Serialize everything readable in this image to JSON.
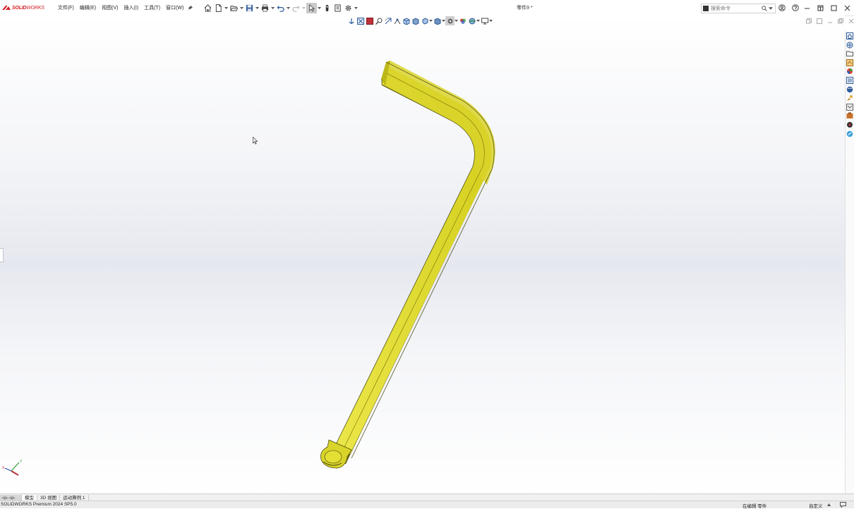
{
  "app": {
    "logo_bold": "SOLID",
    "logo_light": "WORKS",
    "logo_color": "#d42027",
    "document_title": "零件9 *"
  },
  "menus": [
    "文件(F)",
    "编辑(E)",
    "视图(V)",
    "插入(I)",
    "工具(T)",
    "窗口(W)"
  ],
  "search": {
    "placeholder": "搜索命令"
  },
  "toolbar_icons": [
    "home-icon",
    "new-document-icon",
    "open-icon",
    "save-icon",
    "print-icon",
    "undo-icon",
    "redo-icon",
    "select-icon",
    "rebuild-icon",
    "file-properties-icon",
    "options-icon"
  ],
  "heads_up_icons": [
    "section-view-icon",
    "zoom-to-fit-icon",
    "zoom-to-area-icon",
    "previous-view-icon",
    "dynamic-annotation-icon",
    "view-orientation-icon",
    "display-style-icon",
    "hide-show-items-icon",
    "edit-appearance-icon",
    "apply-scene-icon",
    "view-settings-icon",
    "display-icon"
  ],
  "task_pane_icons": [
    "resources-icon",
    "design-library-icon",
    "file-explorer-icon",
    "view-palette-icon",
    "appearances-icon",
    "custom-properties-icon",
    "3dexperience-icon",
    "toolbox-icon",
    "forum-icon",
    "3dcontent-icon",
    "solidworks-assistant-icon",
    "help-circle-icon"
  ],
  "tabs": {
    "scroller": "◀▶◀▶",
    "items": [
      "模型",
      "3D 视图",
      "运动算例 1"
    ],
    "active_index": 0
  },
  "statusbar": {
    "product": "SOLIDWORKS Premium 2024 SP5.0",
    "editing": "在编辑 零件",
    "custom": "自定义"
  },
  "colors": {
    "part_yellow": "#e5e02b",
    "part_dark": "#6f6d0f",
    "background_band": "#e6e8ef"
  },
  "triad": {
    "x_label": "X",
    "y_label": "Y"
  }
}
